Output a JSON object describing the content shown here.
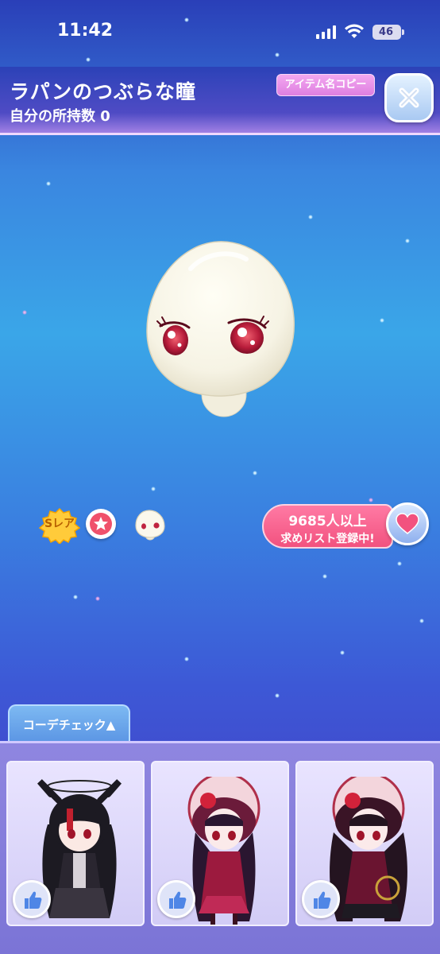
{
  "status_bar": {
    "time": "11:42",
    "battery": "46"
  },
  "header": {
    "title": "ラパンのつぶらな瞳",
    "owned_count": "自分の所持数 0",
    "copy_button": "アイテム名コピー"
  },
  "badges": {
    "rarity": "Sレア"
  },
  "wishlist": {
    "count": "9685人以上",
    "label": "求めリスト登録中!"
  },
  "coord_check": {
    "tab_label": "コーデチェック▲"
  },
  "icons": {
    "close": "close-icon",
    "heart": "heart-icon",
    "star": "star-icon",
    "like": "thumbs-up-icon"
  },
  "colors": {
    "accent_pink": "#f2527f",
    "copy_button": "#de7fe0",
    "panel": "#7b74d6"
  }
}
